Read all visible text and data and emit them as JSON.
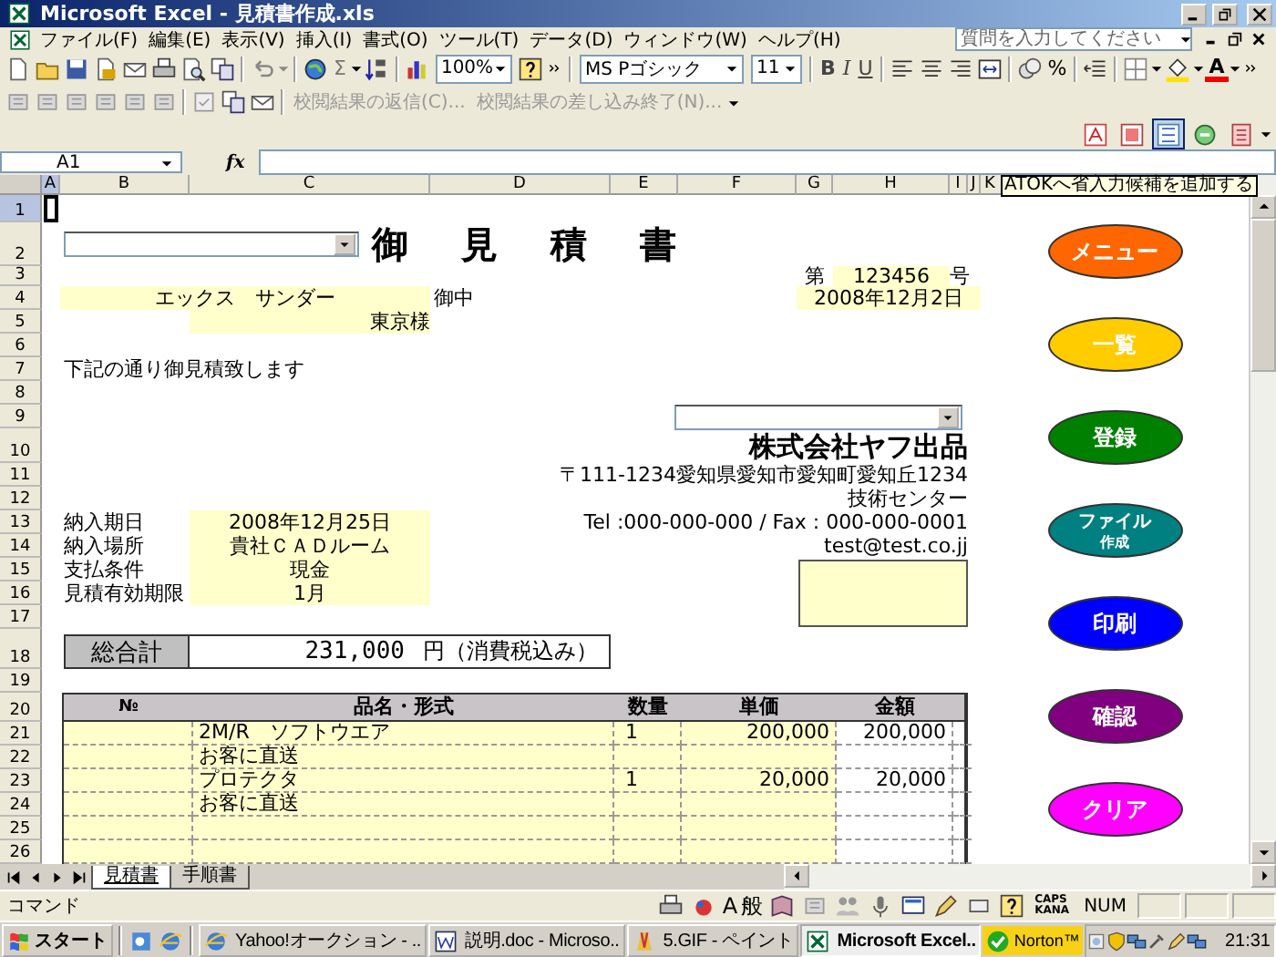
{
  "window": {
    "title": "Microsoft Excel - 見積書作成.xls"
  },
  "menu": {
    "items": [
      "ファイル(F)",
      "編集(E)",
      "表示(V)",
      "挿入(I)",
      "書式(O)",
      "ツール(T)",
      "データ(D)",
      "ウィンドウ(W)",
      "ヘルプ(H)"
    ],
    "help_search": {
      "placeholder": "質問を入力してください"
    }
  },
  "toolbar": {
    "sum": "Σ",
    "zoom": "100%",
    "font": "MS Pゴシック",
    "font_size": "11",
    "bold": "B",
    "italic": "I",
    "underline": "U",
    "percent": "%",
    "font_color": "A"
  },
  "review_toolbar": [
    {
      "label": "校閲結果の返信(C)...",
      "disabled": true
    },
    {
      "label": "校閲結果の差し込み終了(N)...",
      "disabled": true
    }
  ],
  "ime_toolbar": [
    {
      "selected": false
    },
    {
      "selected": false
    },
    {
      "selected": true
    },
    {
      "selected": false
    },
    {
      "selected": false
    }
  ],
  "formula_bar": {
    "name_box": "A1",
    "fx": "fx"
  },
  "tooltip": "ATOKへ省入力候補を追加する",
  "sheet": {
    "columns": [
      {
        "label": "A",
        "selected": true
      },
      {
        "label": "B",
        "selected": false
      },
      {
        "label": "C",
        "selected": false
      },
      {
        "label": "D",
        "selected": false
      },
      {
        "label": "E",
        "selected": false
      },
      {
        "label": "F",
        "selected": false
      },
      {
        "label": "G",
        "selected": false
      },
      {
        "label": "H",
        "selected": false
      },
      {
        "label": "I",
        "selected": false
      },
      {
        "label": "J",
        "selected": false
      },
      {
        "label": "K",
        "selected": false
      }
    ],
    "rows": [
      {
        "label": "1",
        "selected": true
      },
      {
        "label": "2",
        "selected": false
      },
      {
        "label": "3",
        "selected": false
      },
      {
        "label": "4",
        "selected": false
      },
      {
        "label": "5",
        "selected": false
      },
      {
        "label": "6",
        "selected": false
      },
      {
        "label": "7",
        "selected": false
      },
      {
        "label": "8",
        "selected": false
      },
      {
        "label": "9",
        "selected": false
      },
      {
        "label": "10",
        "selected": false
      },
      {
        "label": "11",
        "selected": false
      },
      {
        "label": "12",
        "selected": false
      },
      {
        "label": "13",
        "selected": false
      },
      {
        "label": "14",
        "selected": false
      },
      {
        "label": "15",
        "selected": false
      },
      {
        "label": "16",
        "selected": false
      },
      {
        "label": "17",
        "selected": false
      },
      {
        "label": "18",
        "selected": false
      },
      {
        "label": "19",
        "selected": false
      },
      {
        "label": "20",
        "selected": false
      },
      {
        "label": "21",
        "selected": false
      },
      {
        "label": "22",
        "selected": false
      },
      {
        "label": "23",
        "selected": false
      },
      {
        "label": "24",
        "selected": false
      },
      {
        "label": "25",
        "selected": false
      },
      {
        "label": "26",
        "selected": false
      }
    ]
  },
  "estimate": {
    "title": "御 見 積 書",
    "number_prefix": "第",
    "number": "123456",
    "number_suffix": "号",
    "date": "2008年12月2日",
    "customer": "エックス　サンダー",
    "customer_honorific": "御中",
    "customer_branch": "東京様",
    "intro": "下記の通り御見積致します",
    "company": "株式会社ヤフ出品",
    "address": "〒111-1234愛知県愛知市愛知町愛知丘1234",
    "department": "技術センター",
    "phone_fax": "Tel :000-000-000 / Fax : 000-000-0001",
    "email": "test@test.co.jj",
    "terms": [
      {
        "label": "納入期日",
        "value": "2008年12月25日"
      },
      {
        "label": "納入場所",
        "value": "貴社ＣＡＤルーム"
      },
      {
        "label": "支払条件",
        "value": "現金"
      },
      {
        "label": "見積有効期限",
        "value": "1月"
      }
    ],
    "total": {
      "label": "総合計",
      "value": "231,000",
      "unit": "円（消費税込み）"
    },
    "columns": [
      "№",
      "品名・形式",
      "数量",
      "単価",
      "金額"
    ],
    "items": [
      {
        "kind": "item",
        "name": "2M/R　ソフトウエア",
        "quantity": "1",
        "unit_price": "200,000",
        "amount": "200,000"
      },
      {
        "kind": "item",
        "name": "お客に直送"
      },
      {
        "kind": "item",
        "name": "プロテクタ",
        "quantity": "1",
        "unit_price": "20,000",
        "amount": "20,000"
      },
      {
        "kind": "item",
        "name": "お客に直送"
      },
      {
        "kind": "blank"
      },
      {
        "kind": "blank"
      }
    ]
  },
  "buttons": [
    {
      "label": "メニュー",
      "color": "#ff6600"
    },
    {
      "label": "一覧",
      "color": "#ffcc00"
    },
    {
      "label": "登録",
      "color": "#008000"
    },
    {
      "label": "ファイル",
      "sublabel": "作成",
      "color": "#008080"
    },
    {
      "label": "印刷",
      "color": "#0000ff"
    },
    {
      "label": "確認",
      "color": "#800080"
    },
    {
      "label": "クリア",
      "color": "#ff00ff"
    }
  ],
  "sheet_tabs": [
    {
      "label": "見積書",
      "selected": true
    },
    {
      "label": "手順書",
      "selected": false
    }
  ],
  "status_bar": {
    "mode": "コマンド",
    "ime_mode": "A",
    "ime_input": "般",
    "caps": "CAPS",
    "kana": "KANA",
    "num": "NUM"
  },
  "taskbar": {
    "start": "スタート",
    "tasks": [
      {
        "label": "Yahoo!オークション - ..",
        "selected": false
      },
      {
        "label": "説明.doc - Microso..",
        "selected": false
      },
      {
        "label": "5.GIF - ペイント",
        "selected": false
      },
      {
        "label": "Microsoft Excel..",
        "selected": true
      }
    ],
    "norton": "Norton™",
    "clock": "21:31"
  }
}
